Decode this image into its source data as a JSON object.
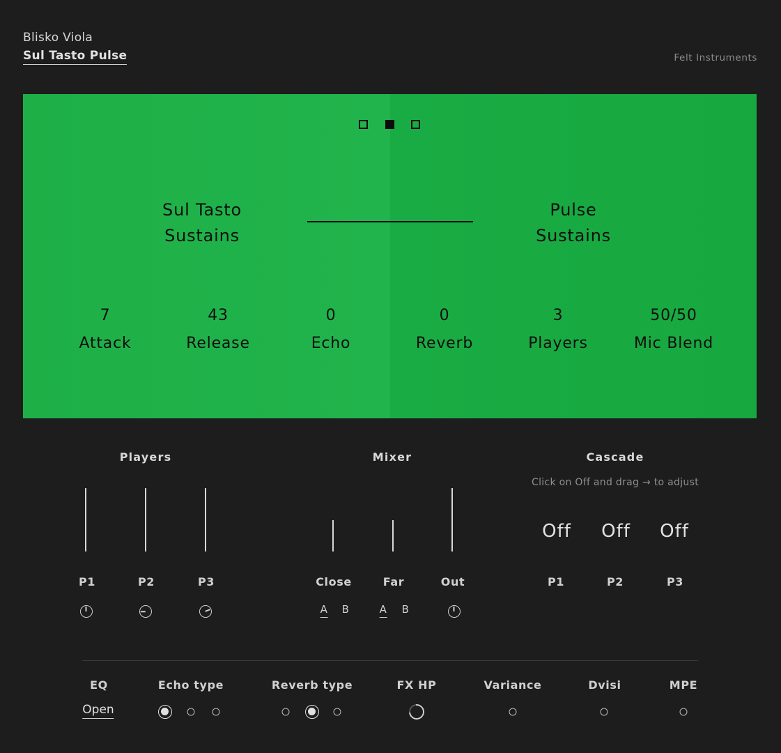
{
  "header": {
    "instrument": "Blisko Viola",
    "preset": "Sul Tasto Pulse",
    "brand": "Felt Instruments"
  },
  "panel": {
    "pages": 3,
    "active_page": 2,
    "layer_a": {
      "line1": "Sul Tasto",
      "line2": "Sustains"
    },
    "layer_b": {
      "line1": "Pulse",
      "line2": "Sustains"
    },
    "params": [
      {
        "value": "7",
        "label": "Attack"
      },
      {
        "value": "43",
        "label": "Release"
      },
      {
        "value": "0",
        "label": "Echo"
      },
      {
        "value": "0",
        "label": "Reverb"
      },
      {
        "value": "3",
        "label": "Players"
      },
      {
        "value": "50/50",
        "label": "Mic Blend"
      }
    ]
  },
  "players": {
    "title": "Players",
    "channels": [
      {
        "label": "P1",
        "level": 1.0,
        "knob_icon": "pan-knob-icon"
      },
      {
        "label": "P2",
        "level": 1.0,
        "knob_icon": "pan-knob-icon"
      },
      {
        "label": "P3",
        "level": 1.0,
        "knob_icon": "pan-knob-icon"
      }
    ]
  },
  "mixer": {
    "title": "Mixer",
    "channels": [
      {
        "label": "Close",
        "level": 0.5,
        "ab": [
          "A",
          "B"
        ],
        "selected": "A"
      },
      {
        "label": "Far",
        "level": 0.5,
        "ab": [
          "A",
          "B"
        ],
        "selected": "A"
      },
      {
        "label": "Out",
        "level": 1.0,
        "knob_icon": "output-knob-icon"
      }
    ]
  },
  "cascade": {
    "title": "Cascade",
    "hint": "Click on Off and drag → to adjust",
    "items": [
      {
        "label": "P1",
        "value": "Off"
      },
      {
        "label": "P2",
        "value": "Off"
      },
      {
        "label": "P3",
        "value": "Off"
      }
    ]
  },
  "bottom": {
    "eq": {
      "label": "EQ",
      "value": "Open"
    },
    "echo_type": {
      "label": "Echo type",
      "options": 3,
      "selected": 1
    },
    "reverb_type": {
      "label": "Reverb type",
      "options": 3,
      "selected": 2
    },
    "fx_hp": {
      "label": "FX HP",
      "icon": "hp-knob-icon"
    },
    "variance": {
      "label": "Variance"
    },
    "dvisi": {
      "label": "Dvisi"
    },
    "mpe": {
      "label": "MPE"
    }
  },
  "colors": {
    "panel_green": "#1eb047",
    "background": "#1d1d1d",
    "text": "#d8d8d8"
  }
}
